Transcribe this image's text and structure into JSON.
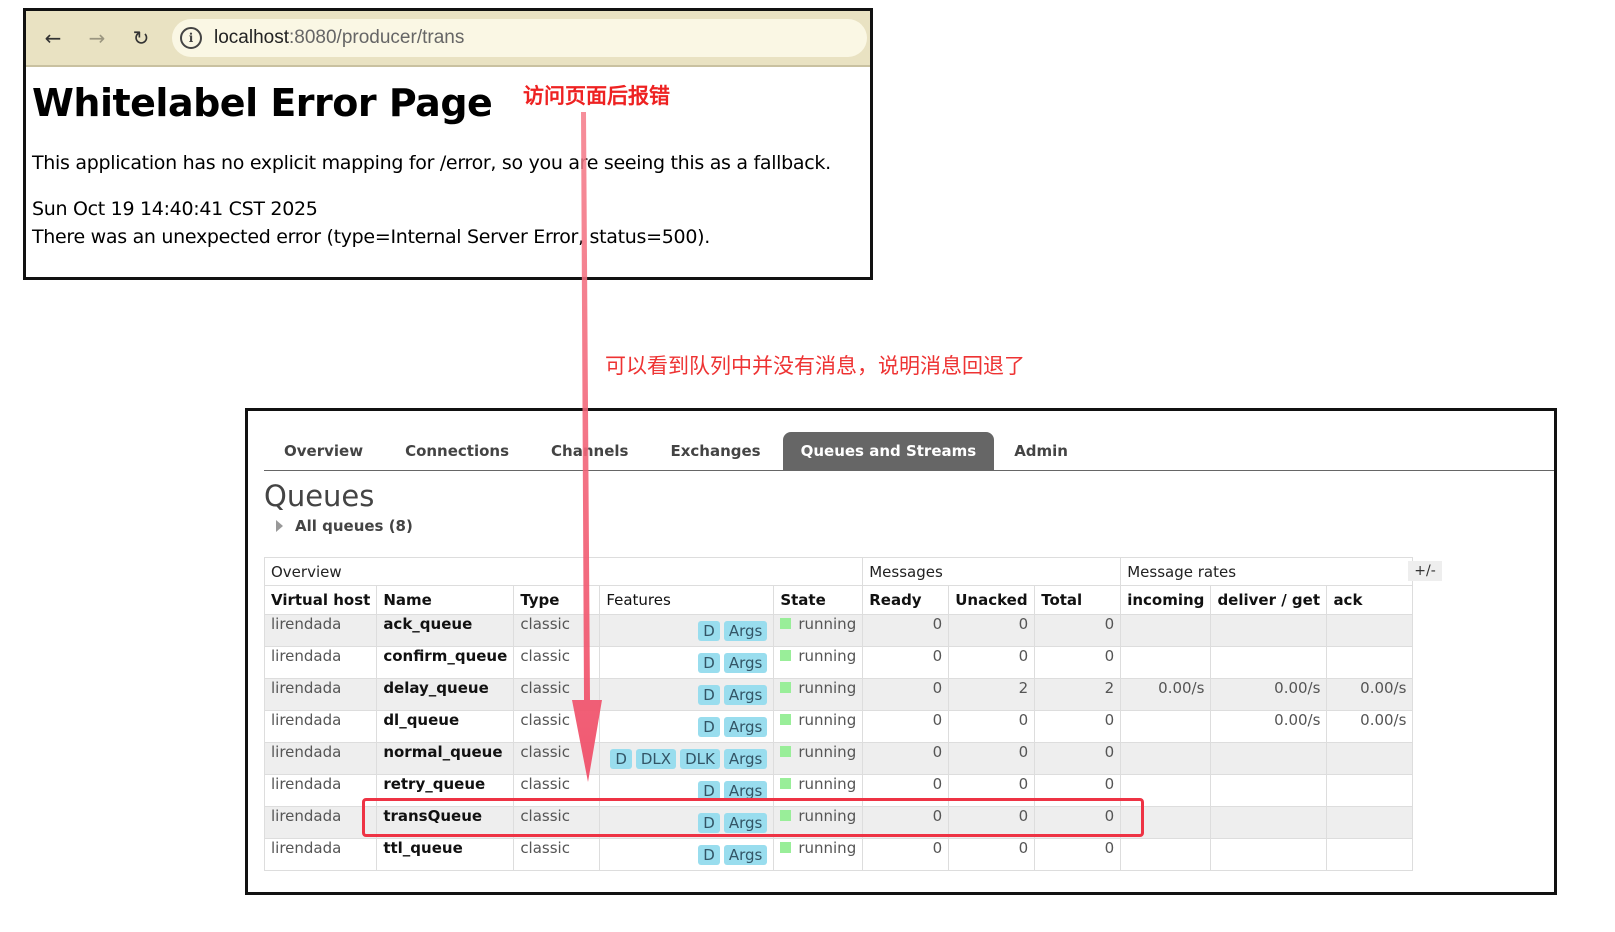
{
  "browser": {
    "url_host": "localhost",
    "url_path": ":8080/producer/trans",
    "back_icon": "arrow-left-icon",
    "forward_icon": "arrow-right-icon",
    "reload_icon": "reload-icon",
    "info_icon": "info-icon"
  },
  "error_page": {
    "title": "Whitelabel Error Page",
    "message": "This application has no explicit mapping for /error, so you are seeing this as a fallback.",
    "timestamp": "Sun Oct 19 14:40:41 CST 2025",
    "detail": "There was an unexpected error (type=Internal Server Error, status=500)."
  },
  "annotations": {
    "error_note": "访问页面后报错",
    "queue_note": "可以看到队列中并没有消息，说明消息回退了",
    "accent_color": "#ee2233"
  },
  "rabbitmq": {
    "tabs": [
      "Overview",
      "Connections",
      "Channels",
      "Exchanges",
      "Queues and Streams",
      "Admin"
    ],
    "active_tab": "Queues and Streams",
    "page_title": "Queues",
    "all_queues_label": "All queues (8)",
    "toggle_columns": "+/-",
    "group_headers": {
      "overview": "Overview",
      "messages": "Messages",
      "rates": "Message rates"
    },
    "columns": {
      "vhost": "Virtual host",
      "name": "Name",
      "type": "Type",
      "features": "Features",
      "state": "State",
      "ready": "Ready",
      "unacked": "Unacked",
      "total": "Total",
      "incoming": "incoming",
      "deliver": "deliver / get",
      "ack": "ack"
    },
    "rows": [
      {
        "vhost": "lirendada",
        "name": "ack_queue",
        "type": "classic",
        "features": [
          "D",
          "Args"
        ],
        "state": "running",
        "ready": "0",
        "unacked": "0",
        "total": "0",
        "incoming": "",
        "deliver": "",
        "ack": ""
      },
      {
        "vhost": "lirendada",
        "name": "confirm_queue",
        "type": "classic",
        "features": [
          "D",
          "Args"
        ],
        "state": "running",
        "ready": "0",
        "unacked": "0",
        "total": "0",
        "incoming": "",
        "deliver": "",
        "ack": ""
      },
      {
        "vhost": "lirendada",
        "name": "delay_queue",
        "type": "classic",
        "features": [
          "D",
          "Args"
        ],
        "state": "running",
        "ready": "0",
        "unacked": "2",
        "total": "2",
        "incoming": "0.00/s",
        "deliver": "0.00/s",
        "ack": "0.00/s"
      },
      {
        "vhost": "lirendada",
        "name": "dl_queue",
        "type": "classic",
        "features": [
          "D",
          "Args"
        ],
        "state": "running",
        "ready": "0",
        "unacked": "0",
        "total": "0",
        "incoming": "",
        "deliver": "0.00/s",
        "ack": "0.00/s"
      },
      {
        "vhost": "lirendada",
        "name": "normal_queue",
        "type": "classic",
        "features": [
          "D",
          "DLX",
          "DLK",
          "Args"
        ],
        "state": "running",
        "ready": "0",
        "unacked": "0",
        "total": "0",
        "incoming": "",
        "deliver": "",
        "ack": ""
      },
      {
        "vhost": "lirendada",
        "name": "retry_queue",
        "type": "classic",
        "features": [
          "D",
          "Args"
        ],
        "state": "running",
        "ready": "0",
        "unacked": "0",
        "total": "0",
        "incoming": "",
        "deliver": "",
        "ack": ""
      },
      {
        "vhost": "lirendada",
        "name": "transQueue",
        "type": "classic",
        "features": [
          "D",
          "Args"
        ],
        "state": "running",
        "ready": "0",
        "unacked": "0",
        "total": "0",
        "incoming": "",
        "deliver": "",
        "ack": ""
      },
      {
        "vhost": "lirendada",
        "name": "ttl_queue",
        "type": "classic",
        "features": [
          "D",
          "Args"
        ],
        "state": "running",
        "ready": "0",
        "unacked": "0",
        "total": "0",
        "incoming": "",
        "deliver": "",
        "ack": ""
      }
    ],
    "highlighted_queue": "transQueue"
  }
}
